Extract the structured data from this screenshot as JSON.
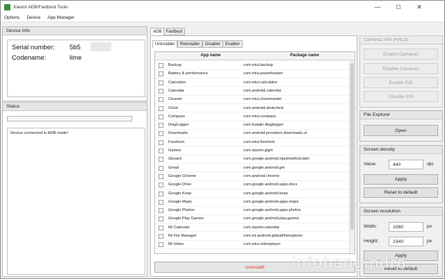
{
  "window": {
    "title": "Xiaomi ADB/Fastboot Tools",
    "controls": {
      "minimize": "—",
      "maximize": "☐",
      "close": "✕"
    }
  },
  "menu": [
    "Options",
    "Device",
    "App Manager"
  ],
  "device_info": {
    "header": "Device Info",
    "serial_label": "Serial number:",
    "serial_value": "5b5",
    "codename_label": "Codename:",
    "codename_value": "lime"
  },
  "status": {
    "header": "Status",
    "progress": 0,
    "log": "Device connected in ADB mode!"
  },
  "main_tabs": [
    "ADB",
    "Fastboot"
  ],
  "sub_tabs": [
    "Uninstaller",
    "Reinstaller",
    "Disabler",
    "Enabler"
  ],
  "table": {
    "headers": [
      "App name",
      "Package name"
    ],
    "rows": [
      [
        "Backup",
        "com.miui.backup"
      ],
      [
        "Battery & performance",
        "com.miui.powerkeeper"
      ],
      [
        "Calculator",
        "com.miui.calculator"
      ],
      [
        "Calendar",
        "com.android.calendar"
      ],
      [
        "Cleaner",
        "com.miui.cleanmaster"
      ],
      [
        "Clock",
        "com.android.deskclock"
      ],
      [
        "Compass",
        "com.miui.compass"
      ],
      [
        "DiagLogger",
        "com.huaqin.diaglogger"
      ],
      [
        "Downloads",
        "com.android.providers.downloads.ui"
      ],
      [
        "Freeform",
        "com.miui.freeform"
      ],
      [
        "Games",
        "com.xiaomi.glgm"
      ],
      [
        "Gboard",
        "com.google.android.inputmethod.latin"
      ],
      [
        "Gmail",
        "com.google.android.gm"
      ],
      [
        "Google Chrome",
        "com.android.chrome"
      ],
      [
        "Google Drive",
        "com.google.android.apps.docs"
      ],
      [
        "Google Keep",
        "com.google.android.keep"
      ],
      [
        "Google Maps",
        "com.google.android.apps.maps"
      ],
      [
        "Google Photos",
        "com.google.android.apps.photos"
      ],
      [
        "Google Play Games",
        "com.google.android.play.games"
      ],
      [
        "Mi Calendar",
        "com.xiaomi.calendar"
      ],
      [
        "Mi File Manager",
        "com.mi.android.globalFileexplorer"
      ],
      [
        "Mi Video",
        "com.miui.videoplayer"
      ]
    ],
    "action": "Uninstall!"
  },
  "camera2": {
    "header": "Camera2 API (HAL3)",
    "buttons": [
      "Enable Camera2",
      "Disable Camera2",
      "Enable EIS",
      "Disable EIS"
    ]
  },
  "file_explorer": {
    "header": "File Explorer",
    "open": "Open"
  },
  "screen_density": {
    "header": "Screen density",
    "value_label": "Value:",
    "value": "440",
    "unit": "dpi",
    "apply": "Apply",
    "reset": "Reset to default"
  },
  "screen_resolution": {
    "header": "Screen resolution",
    "width_label": "Width:",
    "width": "1080",
    "height_label": "Height:",
    "height": "2340",
    "unit": "px",
    "apply": "Apply",
    "reset": "Reset to default"
  },
  "watermark": "infobangindra"
}
